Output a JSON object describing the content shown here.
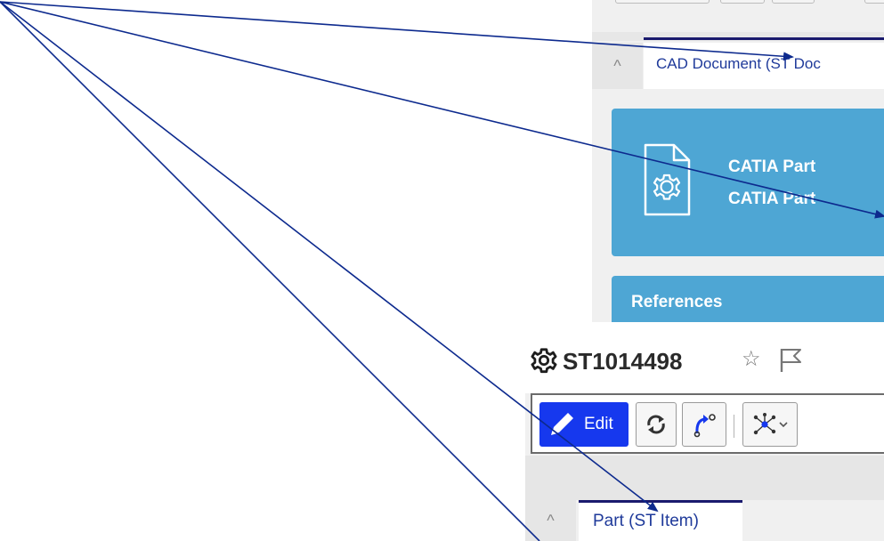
{
  "top_window": {
    "cad_tab_label": "CAD Document (ST Doc",
    "card_line1": "CATIA Part",
    "card_line2": "CATIA Part",
    "references_label": "References"
  },
  "bottom_window": {
    "item_title": "ST1014498",
    "star_glyph": "☆",
    "edit_label": "Edit",
    "part_tab_label": "Part (ST Item)"
  },
  "icons": {
    "collapse": "^",
    "file_gear": "file-gear-icon",
    "gear": "gear-icon",
    "flag": "flag-icon",
    "pencil": "pencil-icon",
    "refresh": "refresh-icon",
    "route": "route-icon",
    "network": "network-icon",
    "chevron": "chevron-down-icon"
  },
  "colors": {
    "card_blue": "#4ea6d4",
    "edit_blue": "#1638ee",
    "tab_text": "#1f3a9a",
    "annotation_arrow": "#0d2a8e"
  }
}
